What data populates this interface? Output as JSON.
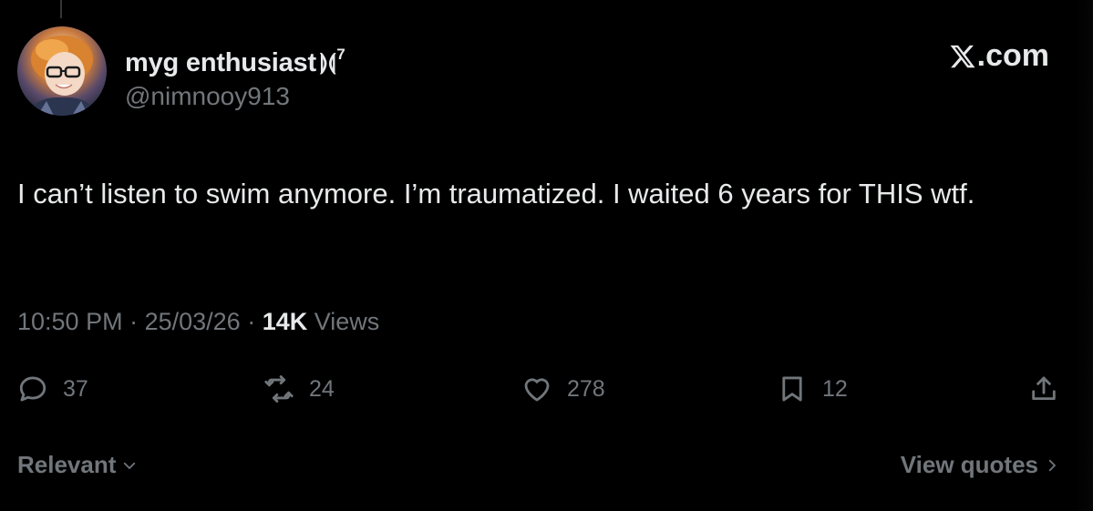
{
  "user": {
    "display_name": "myg enthusiast",
    "name_mark": "⟭⟬",
    "name_sup": "7",
    "handle": "@nimnooy913"
  },
  "brand": {
    "label": ".com",
    "icon": "x-logo-icon"
  },
  "tweet": {
    "text": "I can’t listen to swim anymore. I’m traumatized. I waited 6 years for THIS wtf."
  },
  "meta": {
    "time": "10:50 PM",
    "separator1": " · ",
    "date": "25/03/26",
    "separator2": " · ",
    "views_count": "14K",
    "views_label": " Views"
  },
  "actions": {
    "replies": "37",
    "reposts": "24",
    "likes": "278",
    "bookmarks": "12"
  },
  "footer": {
    "sort_label": "Relevant",
    "quotes_label": "View quotes"
  },
  "colors": {
    "background": "#000000",
    "text_primary": "#e7e9ea",
    "text_secondary": "#71767b"
  }
}
